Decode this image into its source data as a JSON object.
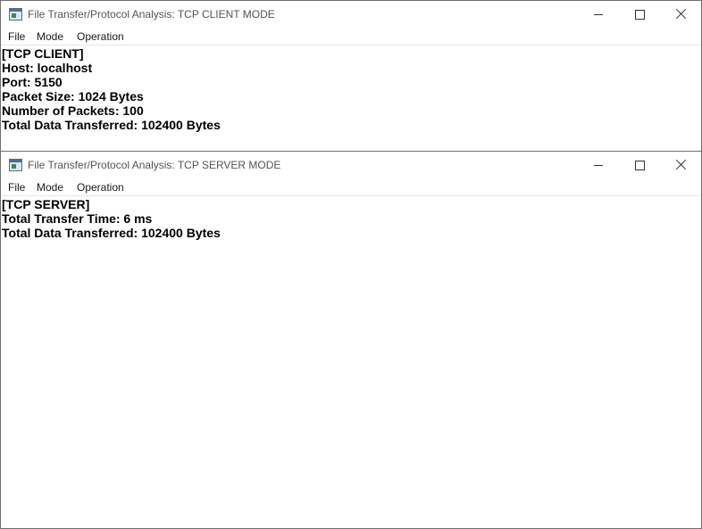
{
  "client_window": {
    "title": "File Transfer/Protocol Analysis: TCP CLIENT MODE",
    "icon": "app-window-icon",
    "menu": [
      "File",
      "Mode",
      "Operation"
    ],
    "lines": [
      "[TCP CLIENT]",
      "Host: localhost",
      "Port: 5150",
      "Packet Size: 1024 Bytes",
      "Number of Packets: 100",
      "Total Data Transferred: 102400 Bytes"
    ]
  },
  "server_window": {
    "title": "File Transfer/Protocol Analysis: TCP SERVER MODE",
    "icon": "app-window-icon",
    "menu": [
      "File",
      "Mode",
      "Operation"
    ],
    "lines": [
      "[TCP SERVER]",
      "Total Transfer Time: 6 ms",
      "Total Data Transferred: 102400 Bytes"
    ]
  }
}
